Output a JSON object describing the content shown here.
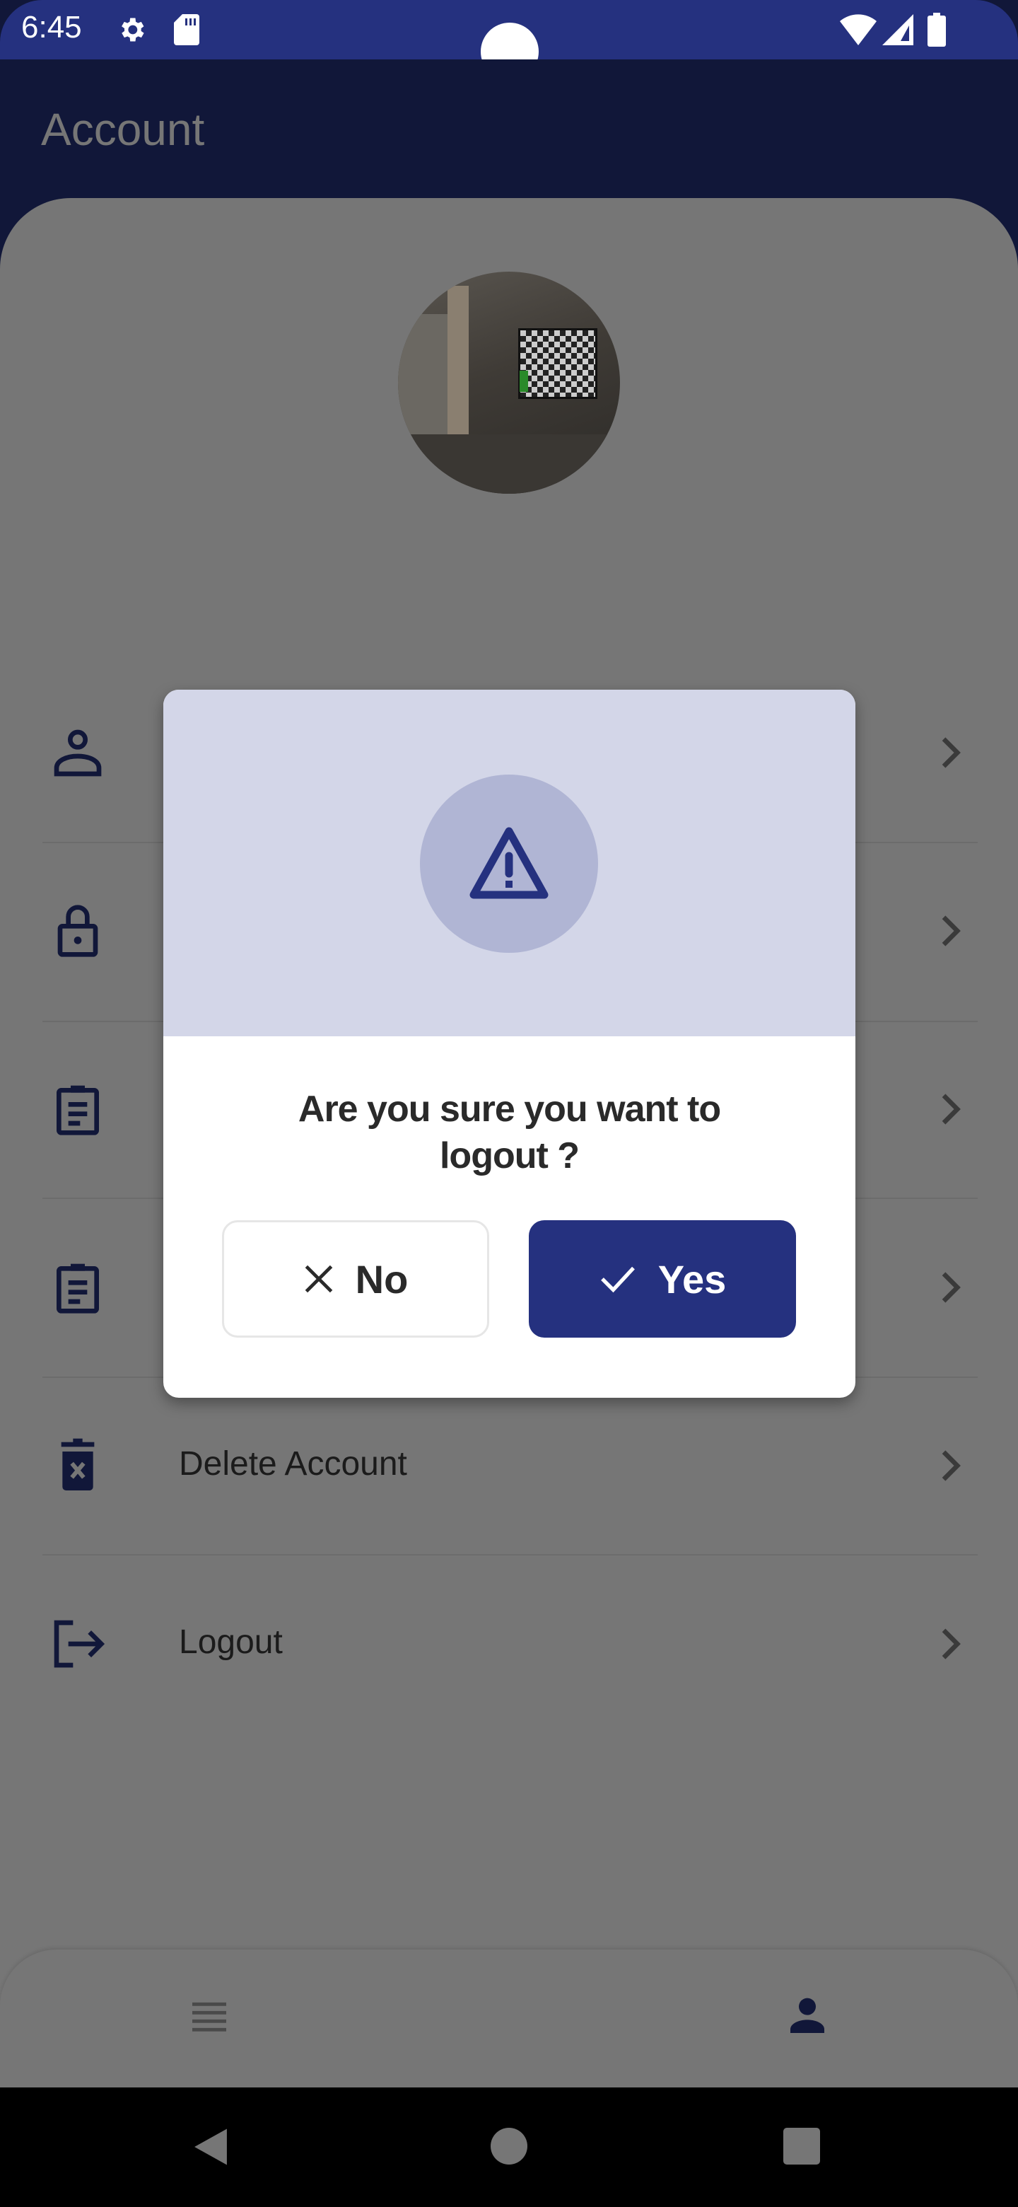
{
  "status_bar": {
    "time": "6:45",
    "icons": [
      "gear-icon",
      "sd-card-icon",
      "wifi-icon",
      "signal-icon",
      "battery-icon"
    ]
  },
  "app_bar": {
    "title": "Account"
  },
  "menu": {
    "items": [
      {
        "icon": "person-icon",
        "label": ""
      },
      {
        "icon": "lock-icon",
        "label": ""
      },
      {
        "icon": "clipboard-icon",
        "label": ""
      },
      {
        "icon": "clipboard-icon",
        "label": ""
      },
      {
        "icon": "trash-icon",
        "label": "Delete Account"
      },
      {
        "icon": "logout-icon",
        "label": "Logout"
      }
    ]
  },
  "dialog": {
    "icon": "warning-icon",
    "message": "Are you sure you want to logout ?",
    "no_label": "No",
    "yes_label": "Yes"
  },
  "bottom_nav": {
    "items": [
      "list-icon",
      "person-icon"
    ]
  },
  "colors": {
    "primary": "#25317f",
    "dark": "#111739",
    "dialog_header": "#d3d6e8"
  }
}
